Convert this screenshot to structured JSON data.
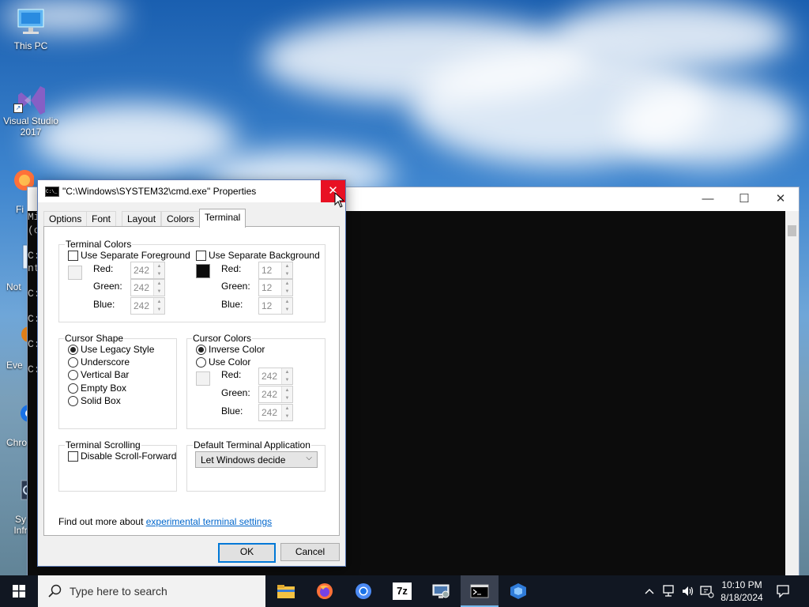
{
  "desktop": {
    "icons": [
      {
        "name": "This PC",
        "label": "This PC"
      },
      {
        "name": "Visual Studio 2017",
        "label": "Visual Studio 2017"
      },
      {
        "name": "Firefox",
        "label": "Fi"
      },
      {
        "name": "Notepad",
        "label": "Not"
      },
      {
        "name": "Event Viewer",
        "label": "Eve"
      },
      {
        "name": "Chrome",
        "label": "Chro"
      },
      {
        "name": "System Information",
        "label": "Sy Infr"
      }
    ]
  },
  "console": {
    "visible_lines": [
      "Mi",
      "(c",
      "C:",
      "nt",
      "C:",
      "C:",
      "C:",
      "C:"
    ],
    "minimize_glyph": "—",
    "maximize_glyph": "☐",
    "close_glyph": "✕"
  },
  "dialog": {
    "title": "\"C:\\Windows\\SYSTEM32\\cmd.exe\" Properties",
    "close_glyph": "✕",
    "app_icon_text": "C:\\_",
    "tabs": [
      "Options",
      "Font",
      "Layout",
      "Colors",
      "Terminal"
    ],
    "active_tab": "Terminal",
    "terminal_colors": {
      "label": "Terminal Colors",
      "foreground": {
        "label": "Use Separate Foreground",
        "checked": false,
        "swatch": "#f2f2f2",
        "red_label": "Red:",
        "red": "242",
        "green_label": "Green:",
        "green": "242",
        "blue_label": "Blue:",
        "blue": "242"
      },
      "background": {
        "label": "Use Separate Background",
        "checked": false,
        "swatch": "#0c0c0c",
        "red_label": "Red:",
        "red": "12",
        "green_label": "Green:",
        "green": "12",
        "blue_label": "Blue:",
        "blue": "12"
      }
    },
    "cursor_shape": {
      "label": "Cursor Shape",
      "options": [
        "Use Legacy Style",
        "Underscore",
        "Vertical Bar",
        "Empty Box",
        "Solid Box"
      ],
      "selected": "Use Legacy Style"
    },
    "cursor_colors": {
      "label": "Cursor Colors",
      "inverse_label": "Inverse Color",
      "use_color_label": "Use Color",
      "selected": "Inverse Color",
      "swatch": "#f2f2f2",
      "red_label": "Red:",
      "red": "242",
      "green_label": "Green:",
      "green": "242",
      "blue_label": "Blue:",
      "blue": "242"
    },
    "terminal_scrolling": {
      "label": "Terminal Scrolling",
      "disable_label": "Disable Scroll-Forward",
      "checked": false
    },
    "default_terminal": {
      "label": "Default Terminal Application",
      "value": "Let Windows decide"
    },
    "footer_text": "Find out more about",
    "footer_link": "experimental terminal settings",
    "ok_label": "OK",
    "cancel_label": "Cancel"
  },
  "taskbar": {
    "search_placeholder": "Type here to search",
    "pinned": [
      "File Explorer",
      "Firefox",
      "Chromium",
      "7-Zip",
      "Computer Management",
      "Command Prompt",
      "Azure Data Studio"
    ],
    "active": "Command Prompt",
    "seven_zip_text": "7z",
    "clock_time": "10:10 PM",
    "clock_date": "8/18/2024"
  },
  "colors": {
    "accent": "#0078d7",
    "close_red": "#e81123",
    "link": "#0066cc",
    "console_bg": "#0c0c0c",
    "taskbar_bg": "#111722"
  }
}
